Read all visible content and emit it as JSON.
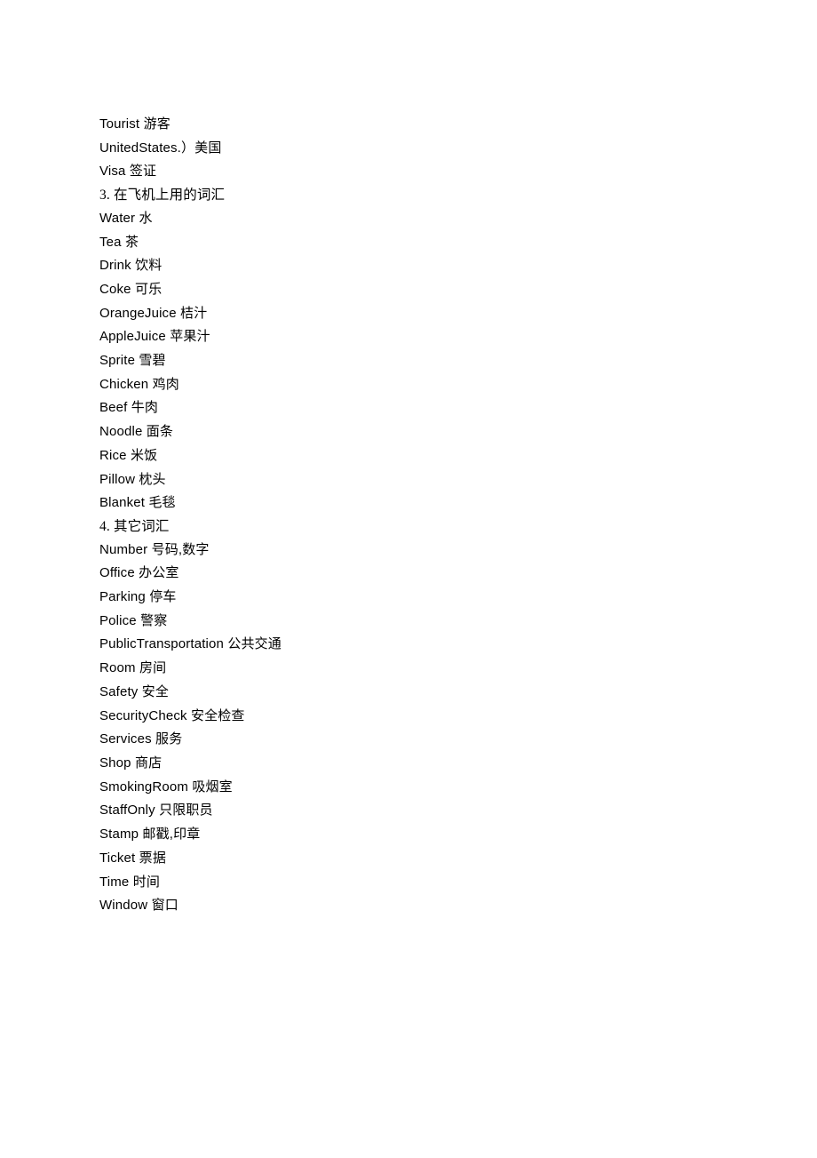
{
  "document": {
    "background_color": "#ffffff",
    "text_color": "#000000",
    "lines": [
      {
        "id": "line-tourist",
        "type": "entry",
        "text": "Tourist 游客"
      },
      {
        "id": "line-united-states",
        "type": "entry",
        "text": "UnitedStates.）美国"
      },
      {
        "id": "line-visa",
        "type": "entry",
        "text": "Visa 签证"
      },
      {
        "id": "line-section-3",
        "type": "heading",
        "text": "3. 在飞机上用的词汇"
      },
      {
        "id": "line-water",
        "type": "entry",
        "text": "Water 水"
      },
      {
        "id": "line-tea",
        "type": "entry",
        "text": "Tea 茶"
      },
      {
        "id": "line-drink",
        "type": "entry",
        "text": "Drink 饮料"
      },
      {
        "id": "line-coke",
        "type": "entry",
        "text": "Coke 可乐"
      },
      {
        "id": "line-orange-juice",
        "type": "entry",
        "text": "OrangeJuice 桔汁"
      },
      {
        "id": "line-apple-juice",
        "type": "entry",
        "text": "AppleJuice 苹果汁"
      },
      {
        "id": "line-sprite",
        "type": "entry",
        "text": "Sprite 雪碧"
      },
      {
        "id": "line-chicken",
        "type": "entry",
        "text": "Chicken 鸡肉"
      },
      {
        "id": "line-beef",
        "type": "entry",
        "text": "Beef 牛肉"
      },
      {
        "id": "line-noodle",
        "type": "entry",
        "text": "Noodle 面条"
      },
      {
        "id": "line-rice",
        "type": "entry",
        "text": "Rice 米饭"
      },
      {
        "id": "line-pillow",
        "type": "entry",
        "text": "Pillow 枕头"
      },
      {
        "id": "line-blanket",
        "type": "entry",
        "text": "Blanket 毛毯"
      },
      {
        "id": "line-section-4",
        "type": "heading",
        "text": "4. 其它词汇"
      },
      {
        "id": "line-number",
        "type": "entry",
        "text": "Number 号码,数字"
      },
      {
        "id": "line-office",
        "type": "entry",
        "text": "Office 办公室"
      },
      {
        "id": "line-parking",
        "type": "entry",
        "text": "Parking 停车"
      },
      {
        "id": "line-police",
        "type": "entry",
        "text": "Police 警察"
      },
      {
        "id": "line-public-transportation",
        "type": "entry",
        "text": "PublicTransportation 公共交通"
      },
      {
        "id": "line-room",
        "type": "entry",
        "text": "Room 房间"
      },
      {
        "id": "line-safety",
        "type": "entry",
        "text": "Safety 安全"
      },
      {
        "id": "line-security-check",
        "type": "entry",
        "text": "SecurityCheck 安全检查"
      },
      {
        "id": "line-services",
        "type": "entry",
        "text": "Services 服务"
      },
      {
        "id": "line-shop",
        "type": "entry",
        "text": "Shop 商店"
      },
      {
        "id": "line-smoking-room",
        "type": "entry",
        "text": "SmokingRoom 吸烟室"
      },
      {
        "id": "line-staff-only",
        "type": "entry",
        "text": "StaffOnly 只限职员"
      },
      {
        "id": "line-stamp",
        "type": "entry",
        "text": "Stamp 邮戳,印章"
      },
      {
        "id": "line-ticket",
        "type": "entry",
        "text": "Ticket 票据"
      },
      {
        "id": "line-time",
        "type": "entry",
        "text": "Time 时间"
      },
      {
        "id": "line-window",
        "type": "entry",
        "text": "Window 窗口"
      }
    ]
  }
}
